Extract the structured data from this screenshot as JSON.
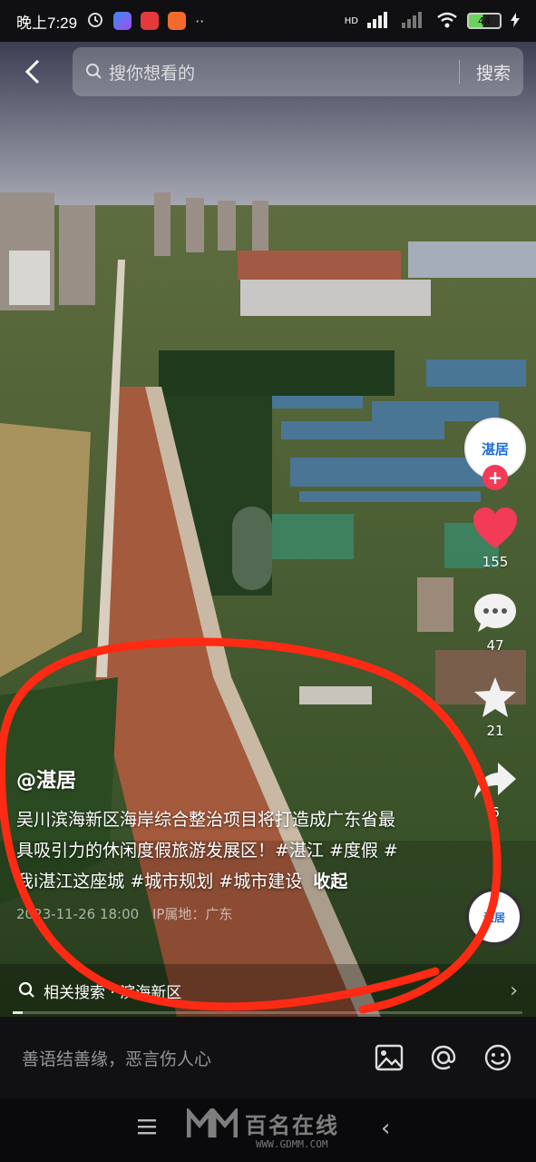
{
  "status_bar": {
    "time": "晚上7:29",
    "network": "HD",
    "battery": "44"
  },
  "search": {
    "placeholder": "搜你想看的",
    "button": "搜索"
  },
  "rail": {
    "avatar_text": "湛居",
    "like_count": "155",
    "comment_count": "47",
    "favorite_count": "21",
    "share_count": "6",
    "music_text": "湛居"
  },
  "caption": {
    "author": "@湛居",
    "description": "吴川滨海新区海岸综合整治项目将打造成广东省最具吸引力的休闲度假旅游发展区！#湛江 #度假 #我i湛江这座城 #城市规划 #城市建设",
    "collapse": "收起",
    "date": "2023-11-26 18:00",
    "location": "IP属地：广东"
  },
  "related": {
    "label": "相关搜索 · 滨海新区"
  },
  "progress": {
    "fraction": 0.02
  },
  "comment_bar": {
    "placeholder": "善语结善缘，恶言伤人心"
  },
  "watermark": {
    "text": "百名在线",
    "url": "WWW.GDMM.COM"
  },
  "colors": {
    "like": "#f13b57",
    "annotation": "#ff2a14"
  }
}
